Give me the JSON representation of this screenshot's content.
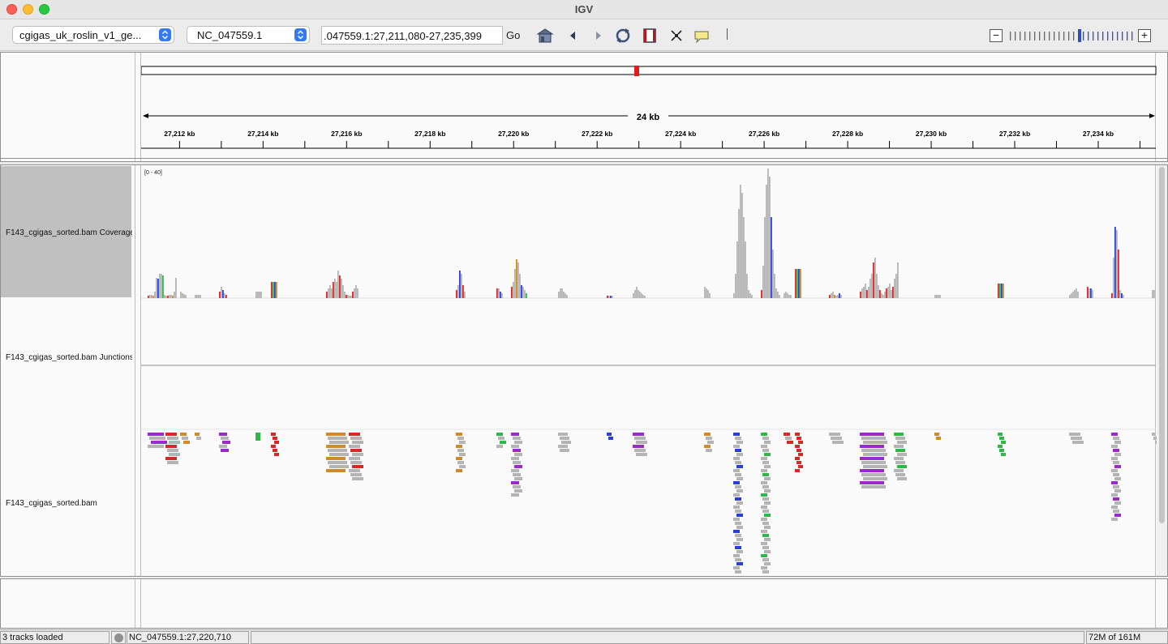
{
  "window": {
    "title": "IGV"
  },
  "toolbar": {
    "genome": "cgigas_uk_roslin_v1_ge...",
    "chromosome": "NC_047559.1",
    "locus": ".047559.1:27,211,080-27,235,399",
    "go_label": "Go"
  },
  "ruler": {
    "span_label": "24 kb",
    "ticks": [
      "27,212 kb",
      "27,214 kb",
      "27,216 kb",
      "27,218 kb",
      "27,220 kb",
      "27,222 kb",
      "27,224 kb",
      "27,226 kb",
      "27,228 kb",
      "27,230 kb",
      "27,232 kb",
      "27,234 kb"
    ]
  },
  "tracks": {
    "coverage_label": "F143_cgigas_sorted.bam Coverage",
    "coverage_range": "[0 - 40]",
    "junction_label": "F143_cgigas_sorted.bam Junctions",
    "alignment_label": "F143_cgigas_sorted.bam"
  },
  "status": {
    "tracks_loaded": "3 tracks loaded",
    "position": "NC_047559.1:27,220,710",
    "memory": "72M of 161M"
  },
  "colors": {
    "coverage_grey": "#b4b4b4",
    "mismatch_red": "#d62828",
    "mismatch_green": "#2fb84a",
    "mismatch_blue": "#2a3fd6",
    "mismatch_orange": "#d08a2a",
    "mismatch_purple": "#9b2ac8",
    "locator_red": "#e31b1b",
    "selected_name_bg": "#c0c0c0"
  }
}
